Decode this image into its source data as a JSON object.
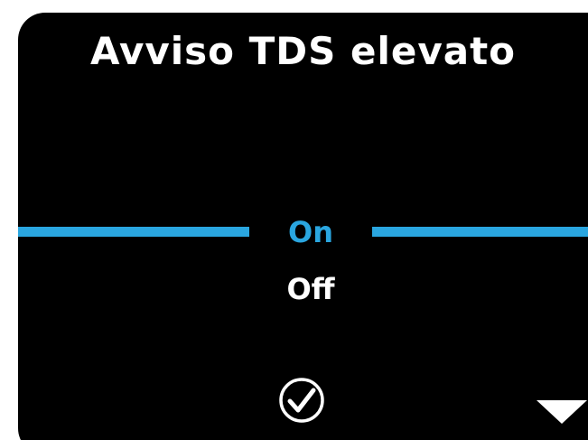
{
  "screen": {
    "title": "Avviso TDS elevato",
    "accent_color": "#2aa6e0",
    "options": [
      {
        "label": "On",
        "selected": true
      },
      {
        "label": "Off",
        "selected": false
      }
    ],
    "confirm_icon": "check-circle-icon",
    "scroll_icon": "triangle-down-icon"
  }
}
